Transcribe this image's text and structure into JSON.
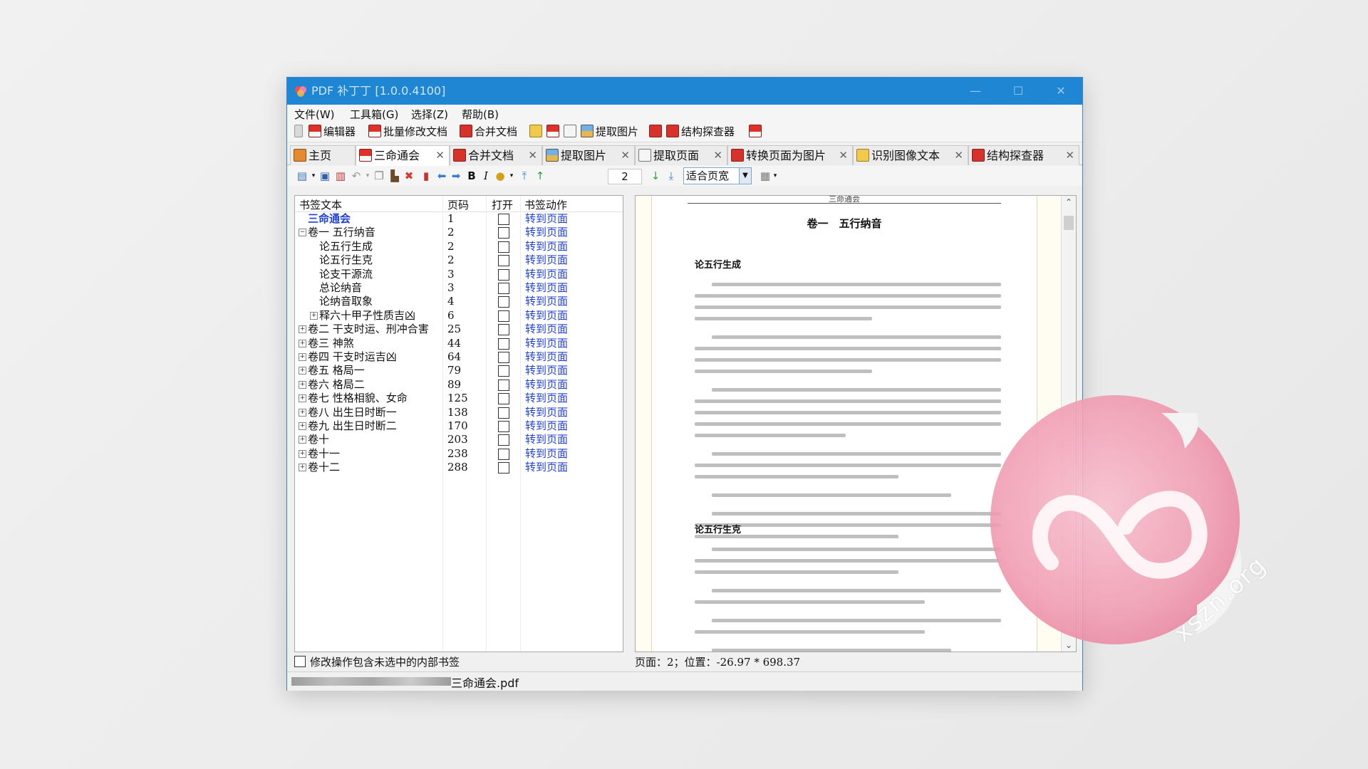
{
  "window": {
    "title": "PDF 补丁丁 [1.0.0.4100]",
    "controls": {
      "minimize": "—",
      "maximize": "☐",
      "close": "✕"
    }
  },
  "menu": [
    "文件(W)",
    "工具箱(G)",
    "选择(Z)",
    "帮助(B)"
  ],
  "toolbar": {
    "editor": "编辑器",
    "batch_modify": "批量修改文档",
    "merge": "合并文档",
    "extract_images": "提取图片",
    "structure_explorer": "结构探查器"
  },
  "tabs": [
    {
      "label": "主页",
      "active": false,
      "closable": false
    },
    {
      "label": "三命通会",
      "active": true,
      "closable": true
    },
    {
      "label": "合并文档",
      "active": false,
      "closable": true
    },
    {
      "label": "提取图片",
      "active": false,
      "closable": true
    },
    {
      "label": "提取页面",
      "active": false,
      "closable": true
    },
    {
      "label": "转换页面为图片",
      "active": false,
      "closable": true
    },
    {
      "label": "识别图像文本",
      "active": false,
      "closable": true
    },
    {
      "label": "结构探查器",
      "active": false,
      "closable": true
    }
  ],
  "editor_toolbar": {
    "bold": "B",
    "italic": "I",
    "page_number": "2",
    "zoom_mode": "适合页宽"
  },
  "bookmarks": {
    "headers": {
      "text": "书签文本",
      "page": "页码",
      "open": "打开",
      "action": "书签动作"
    },
    "rows": [
      {
        "text": "三命通会",
        "page": "1",
        "action": "转到页面",
        "level": 0,
        "toggle": "",
        "highlight": true
      },
      {
        "text": "卷一 五行纳音",
        "page": "2",
        "action": "转到页面",
        "level": 0,
        "toggle": "−"
      },
      {
        "text": "论五行生成",
        "page": "2",
        "action": "转到页面",
        "level": 1,
        "toggle": ""
      },
      {
        "text": "论五行生克",
        "page": "2",
        "action": "转到页面",
        "level": 1,
        "toggle": ""
      },
      {
        "text": "论支干源流",
        "page": "3",
        "action": "转到页面",
        "level": 1,
        "toggle": ""
      },
      {
        "text": "总论纳音",
        "page": "3",
        "action": "转到页面",
        "level": 1,
        "toggle": ""
      },
      {
        "text": "论纳音取象",
        "page": "4",
        "action": "转到页面",
        "level": 1,
        "toggle": ""
      },
      {
        "text": "释六十甲子性质吉凶",
        "page": "6",
        "action": "转到页面",
        "level": 1,
        "toggle": "+"
      },
      {
        "text": "卷二 干支时运、刑冲合害",
        "page": "25",
        "action": "转到页面",
        "level": 0,
        "toggle": "+"
      },
      {
        "text": "卷三 神煞",
        "page": "44",
        "action": "转到页面",
        "level": 0,
        "toggle": "+"
      },
      {
        "text": "卷四 干支时运吉凶",
        "page": "64",
        "action": "转到页面",
        "level": 0,
        "toggle": "+"
      },
      {
        "text": "卷五 格局一",
        "page": "79",
        "action": "转到页面",
        "level": 0,
        "toggle": "+"
      },
      {
        "text": "卷六 格局二",
        "page": "89",
        "action": "转到页面",
        "level": 0,
        "toggle": "+"
      },
      {
        "text": "卷七 性格相貌、女命",
        "page": "125",
        "action": "转到页面",
        "level": 0,
        "toggle": "+"
      },
      {
        "text": "卷八 出生日时断一",
        "page": "138",
        "action": "转到页面",
        "level": 0,
        "toggle": "+"
      },
      {
        "text": "卷九 出生日时断二",
        "page": "170",
        "action": "转到页面",
        "level": 0,
        "toggle": "+"
      },
      {
        "text": "卷十",
        "page": "203",
        "action": "转到页面",
        "level": 0,
        "toggle": "+"
      },
      {
        "text": "卷十一",
        "page": "238",
        "action": "转到页面",
        "level": 0,
        "toggle": "+"
      },
      {
        "text": "卷十二",
        "page": "288",
        "action": "转到页面",
        "level": 0,
        "toggle": "+"
      }
    ]
  },
  "footer": {
    "checkbox_label": "修改操作包含未选中的内部书签",
    "status": "页面：2；位置：-26.97 * 698.37",
    "filename": "三命通会.pdf"
  },
  "document": {
    "running_head": "三命通会",
    "chapter_title": "卷一　五行纳音",
    "sections": [
      "论五行生成",
      "论五行生克"
    ]
  },
  "watermark": "xszn.org"
}
